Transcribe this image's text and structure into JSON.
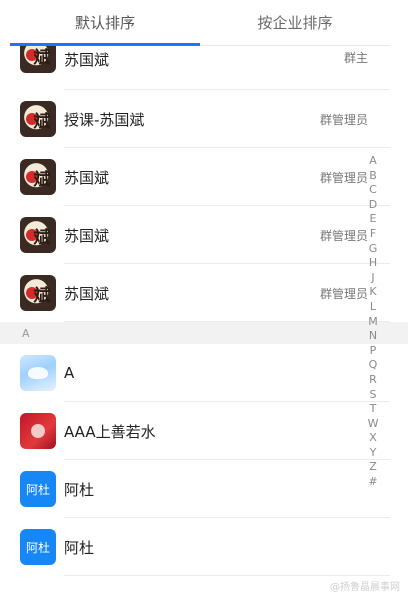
{
  "tabs": [
    {
      "label": "默认排序",
      "active": true
    },
    {
      "label": "按企业排序",
      "active": false
    }
  ],
  "members": [
    {
      "name": "苏国斌",
      "role": "群主",
      "avatar": "game-icon",
      "avatar_text": "斌"
    },
    {
      "name": "授课-苏国斌",
      "role": "群管理员",
      "avatar": "game-icon",
      "avatar_text": "斌"
    },
    {
      "name": "苏国斌",
      "role": "群管理员",
      "avatar": "game-icon",
      "avatar_text": "斌"
    },
    {
      "name": "苏国斌",
      "role": "群管理员",
      "avatar": "game-icon",
      "avatar_text": "斌"
    },
    {
      "name": "苏国斌",
      "role": "群管理员",
      "avatar": "game-icon",
      "avatar_text": "斌"
    }
  ],
  "section_a": {
    "header": "A",
    "members": [
      {
        "name": "A",
        "role": "",
        "avatar": "sky-image"
      },
      {
        "name": "AAA上善若水",
        "role": "",
        "avatar": "red-image"
      },
      {
        "name": "阿杜",
        "role": "",
        "avatar": "text-avatar",
        "avatar_text": "阿杜"
      },
      {
        "name": "阿杜",
        "role": "",
        "avatar": "text-avatar",
        "avatar_text": "阿杜"
      }
    ]
  },
  "index_letters": [
    "A",
    "B",
    "C",
    "D",
    "E",
    "F",
    "G",
    "H",
    "J",
    "K",
    "L",
    "M",
    "N",
    "P",
    "Q",
    "R",
    "S",
    "T",
    "W",
    "X",
    "Y",
    "Z",
    "#"
  ],
  "watermark": "@扬鲁晶晨事网",
  "colors": {
    "accent": "#1677ff",
    "text_avatar_bg": "#1787f5"
  }
}
